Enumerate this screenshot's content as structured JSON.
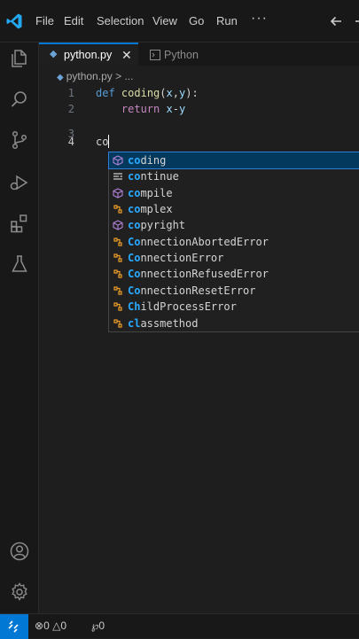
{
  "menubar": {
    "items": [
      "File",
      "Edit",
      "Selection",
      "View",
      "Go",
      "Run"
    ],
    "more": "···"
  },
  "tabs": [
    {
      "label": "python.py",
      "close": "✕"
    },
    {
      "label": "Python"
    }
  ],
  "breadcrumb": {
    "file": "python.py",
    "sep": " > ",
    "rest": "..."
  },
  "editor": {
    "lines": [
      {
        "num": "1",
        "tokens": [
          {
            "t": "def",
            "c": "kw"
          },
          {
            "t": " "
          },
          {
            "t": "coding",
            "c": "fn"
          },
          {
            "t": "("
          },
          {
            "t": "x",
            "c": "var"
          },
          {
            "t": ","
          },
          {
            "t": "y",
            "c": "var"
          },
          {
            "t": "):"
          }
        ]
      },
      {
        "num": "2",
        "tokens": [
          {
            "t": "    "
          },
          {
            "t": "return",
            "c": "kw2"
          },
          {
            "t": " "
          },
          {
            "t": "x",
            "c": "var"
          },
          {
            "t": "-"
          },
          {
            "t": "y",
            "c": "var"
          }
        ]
      },
      {
        "num": "3",
        "tokens": []
      },
      {
        "num": "4",
        "tokens": [
          {
            "t": "co"
          }
        ],
        "cursor": true
      }
    ]
  },
  "suggestions": {
    "query": "co",
    "items": [
      {
        "label": "coding",
        "kind": "function",
        "selected": true
      },
      {
        "label": "continue",
        "kind": "keyword"
      },
      {
        "label": "compile",
        "kind": "function"
      },
      {
        "label": "complex",
        "kind": "class"
      },
      {
        "label": "copyright",
        "kind": "function"
      },
      {
        "label": "ConnectionAbortedError",
        "kind": "class"
      },
      {
        "label": "ConnectionError",
        "kind": "class"
      },
      {
        "label": "ConnectionRefusedError",
        "kind": "class"
      },
      {
        "label": "ConnectionResetError",
        "kind": "class"
      },
      {
        "label": "ChildProcessError",
        "kind": "class"
      },
      {
        "label": "classmethod",
        "kind": "class"
      }
    ]
  },
  "statusbar": {
    "errors": "0",
    "warnings": "0",
    "ports": "0"
  },
  "colors": {
    "accent": "#0078d4",
    "function_icon": "#b180d7",
    "class_icon": "#ee9d28",
    "match_highlight": "#2aaaff"
  }
}
